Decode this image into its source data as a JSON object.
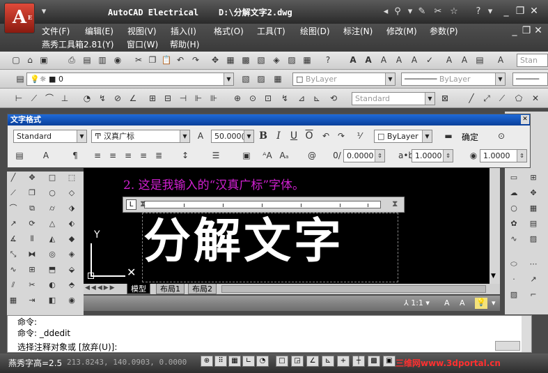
{
  "window": {
    "app_name": "AutoCAD Electrical",
    "document": "D:\\分解文字2.dwg",
    "logo_letter": "A",
    "logo_sub": "E"
  },
  "menu": {
    "row1": [
      "文件(F)",
      "编辑(E)",
      "视图(V)",
      "插入(I)",
      "格式(O)",
      "工具(T)",
      "绘图(D)",
      "标注(N)",
      "修改(M)",
      "参数(P)"
    ],
    "row2": [
      "燕秀工具箱2.81(Y)",
      "窗口(W)",
      "帮助(H)"
    ]
  },
  "toolbars": {
    "style_combo": "Stan",
    "layer_value": "0",
    "color_combo": "ByLayer",
    "linetype_combo": "ByLayer",
    "dimstyle_combo": "Standard"
  },
  "text_format": {
    "title": "文字格式",
    "style": "Standard",
    "font": "汉真广标",
    "height": "50.000(",
    "color": "ByLayer",
    "ok_label": "确定",
    "oblique": "0.0000",
    "tracking": "1.0000",
    "width_factor": "1.0000"
  },
  "drawing": {
    "note": "2. 这是我输入的“汉真广标”字体。",
    "big_text": "分解文字",
    "ucs_y": "Y"
  },
  "tabs": [
    "模型",
    "布局1",
    "布局2"
  ],
  "annotation_scale": "1:1",
  "command": {
    "line1": "命令:",
    "line2": "命令: _ddedit",
    "line3": "选择注释对象或 [放弃(U)]:"
  },
  "status": {
    "label": "燕秀字高=2.5",
    "coords": "213.8243, 140.0903, 0.0000",
    "model_label": "模型"
  },
  "watermark": "三维网www.3dportal.cn",
  "colors": {
    "title_bg": "#3a3a3a",
    "dialog_title": "#0a3f9a",
    "note_text": "#d020d0"
  }
}
